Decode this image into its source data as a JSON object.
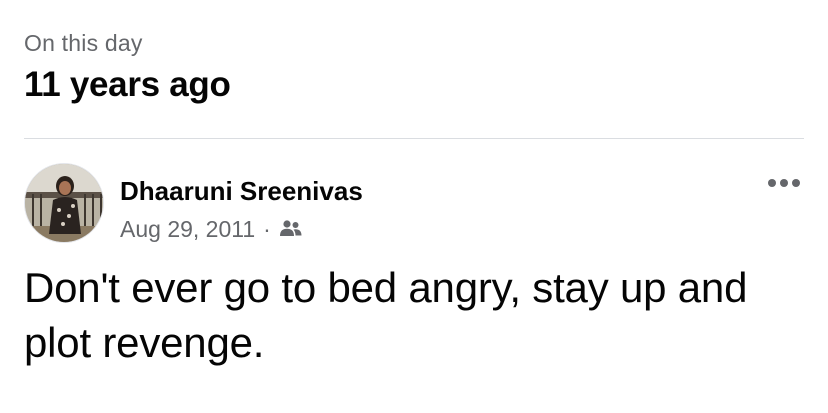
{
  "memory": {
    "eyebrow": "On this day",
    "years_ago": "11 years ago"
  },
  "post": {
    "author": "Dhaaruni Sreenivas",
    "date": "Aug 29, 2011",
    "separator": "·",
    "audience_icon": "friends-icon",
    "more_icon": "more-icon",
    "text": "Don't ever go to bed angry, stay up and plot revenge."
  },
  "colors": {
    "primary_text": "#050505",
    "secondary_text": "#65676b",
    "divider": "#dadde1"
  }
}
